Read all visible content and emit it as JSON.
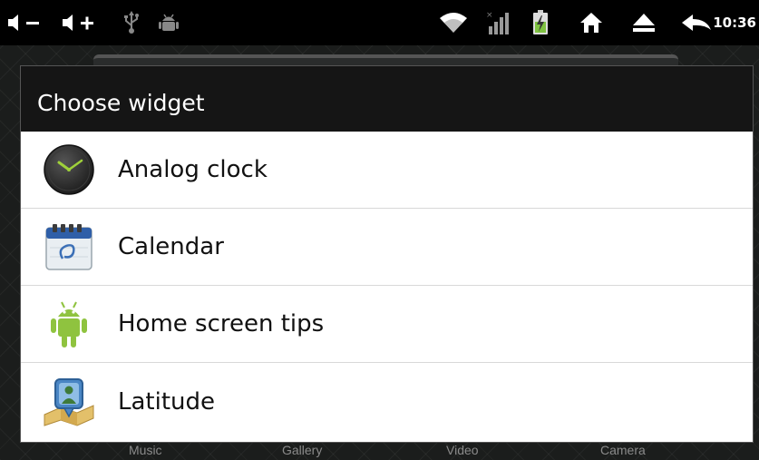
{
  "status_bar": {
    "time": "10:36",
    "icons": [
      "volume-down-icon",
      "volume-up-icon",
      "usb-icon",
      "android-debug-icon",
      "wifi-icon",
      "signal-icon",
      "battery-charging-icon",
      "home-icon",
      "eject-icon",
      "back-icon"
    ],
    "volume_down_glyph": "−",
    "volume_up_glyph": "+"
  },
  "dialog": {
    "title": "Choose widget",
    "items": [
      {
        "label": "Analog clock",
        "icon": "analog-clock-icon"
      },
      {
        "label": "Calendar",
        "icon": "calendar-icon"
      },
      {
        "label": "Home screen tips",
        "icon": "android-robot-icon"
      },
      {
        "label": "Latitude",
        "icon": "latitude-icon"
      }
    ]
  },
  "dock": {
    "items": [
      "Music",
      "Gallery",
      "Video",
      "Camera"
    ]
  },
  "colors": {
    "status_bar_bg": "#000000",
    "dialog_title_bg": "#151515",
    "dialog_bg": "#ffffff",
    "android_green": "#8fc33f"
  }
}
